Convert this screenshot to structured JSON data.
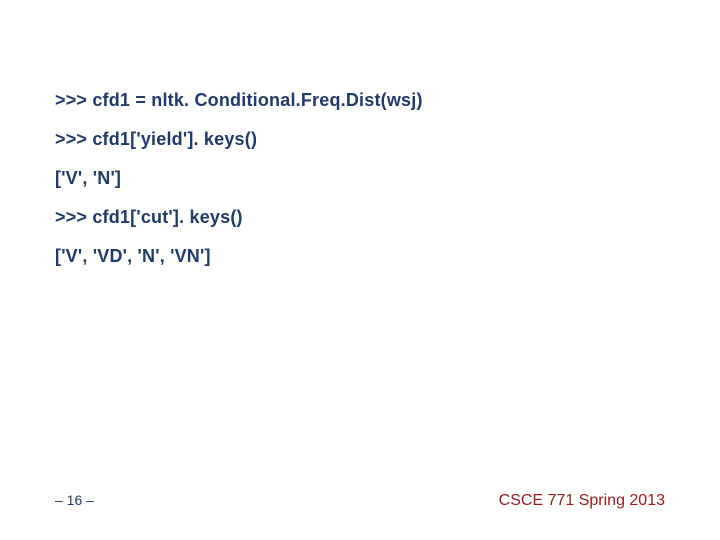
{
  "lines": [
    ">>> cfd1 = nltk. Conditional.Freq.Dist(wsj)",
    ">>> cfd1['yield']. keys()",
    "['V', 'N']",
    ">>> cfd1['cut']. keys()",
    "['V', 'VD', 'N', 'VN']"
  ],
  "footer": {
    "page": "– 16 –",
    "course": "CSCE 771 Spring 2013"
  }
}
